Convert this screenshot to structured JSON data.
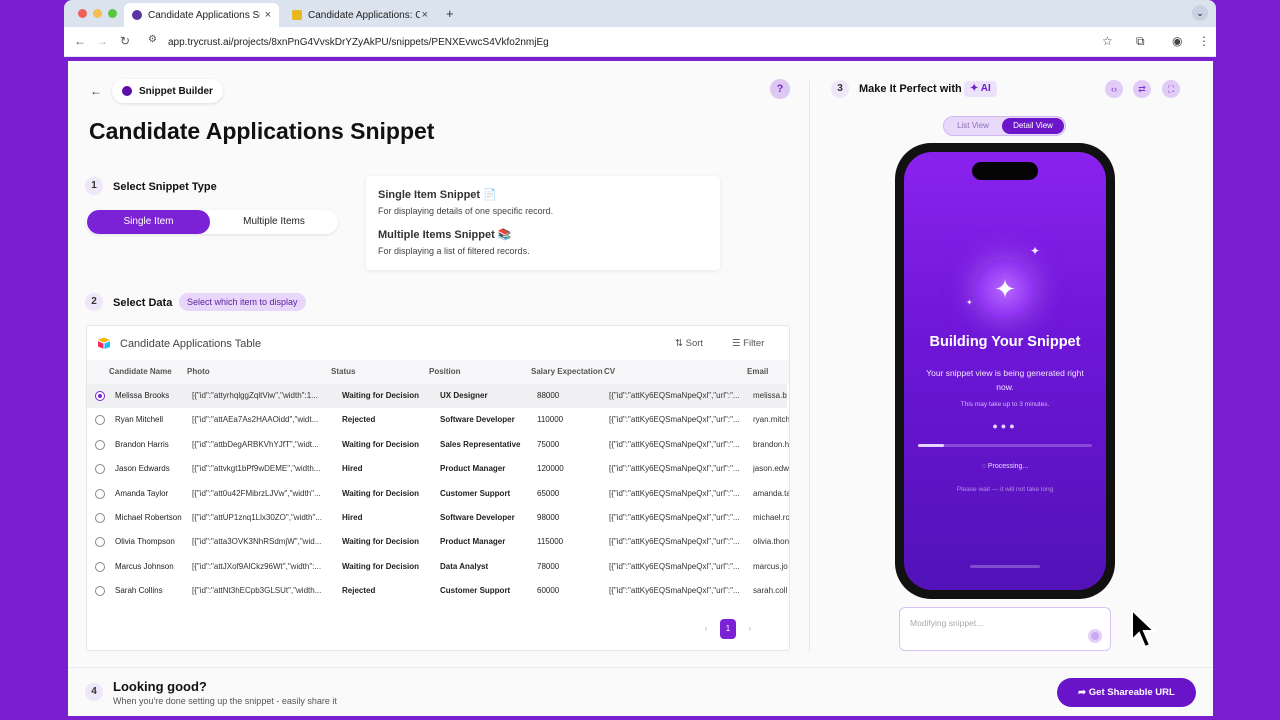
{
  "browser": {
    "tabs": [
      {
        "title": "Candidate Applications Snipp",
        "close": "×"
      },
      {
        "title": "Candidate Applications: Cand",
        "close": "×"
      }
    ],
    "new_tab": "+",
    "url": "app.trycrust.ai/projects/8xnPnG4VvskDrYZyAkPU/snippets/PENXEvwcS4Vkfo2nmjEg"
  },
  "builder": {
    "breadcrumb": "Snippet Builder",
    "title": "Candidate Applications Snippet",
    "step1": {
      "num": "1",
      "title": "Select Snippet Type",
      "options": [
        "Single Item",
        "Multiple Items"
      ],
      "selected": "Single Item"
    },
    "info": [
      {
        "title": "Single Item Snippet 📄",
        "desc": "For displaying details of one specific record."
      },
      {
        "title": "Multiple Items Snippet 📚",
        "desc": "For displaying a list of filtered records."
      }
    ],
    "step2": {
      "num": "2",
      "title": "Select Data",
      "hint": "Select which item to display"
    },
    "step4": {
      "num": "4",
      "title": "Looking good?",
      "desc": "When you're done setting up the snippet - easily share it"
    },
    "share_button": "Get Shareable URL"
  },
  "table": {
    "name": "Candidate Applications Table",
    "sort": "Sort",
    "filter": "Filter",
    "columns": [
      "Candidate Name",
      "Photo",
      "Status",
      "Position",
      "Salary Expectation",
      "CV",
      "Email"
    ],
    "rows": [
      {
        "name": "Melissa Brooks",
        "photo": "[{\"id\":\"attyrhqlggZqltViw\",\"width\":1...",
        "status": "Waiting for Decision",
        "position": "UX Designer",
        "salary": "88000",
        "cv": "[{\"id\":\"attKy6EQSmaNpeQxl\",\"url\":\"...",
        "email": "melissa.b",
        "selected": true
      },
      {
        "name": "Ryan Mitchell",
        "photo": "[{\"id\":\"attAEa7As2HAAOidd\",\"widt...",
        "status": "Rejected",
        "position": "Software Developer",
        "salary": "110000",
        "cv": "[{\"id\":\"attKy6EQSmaNpeQxl\",\"url\":\"...",
        "email": "ryan.mitch"
      },
      {
        "name": "Brandon Harris",
        "photo": "[{\"id\":\"attbDegARBKVhYJfT\",\"widt...",
        "status": "Waiting for Decision",
        "position": "Sales Representative",
        "salary": "75000",
        "cv": "[{\"id\":\"attKy6EQSmaNpeQxl\",\"url\":\"...",
        "email": "brandon.h"
      },
      {
        "name": "Jason Edwards",
        "photo": "[{\"id\":\"attvkgt1bPf9wDEME\",\"width...",
        "status": "Hired",
        "position": "Product Manager",
        "salary": "120000",
        "cv": "[{\"id\":\"attKy6EQSmaNpeQxl\",\"url\":\"...",
        "email": "jason.edw"
      },
      {
        "name": "Amanda Taylor",
        "photo": "[{\"id\":\"att0u42FMibrzLJVw\",\"width\"...",
        "status": "Waiting for Decision",
        "position": "Customer Support",
        "salary": "65000",
        "cv": "[{\"id\":\"attKy6EQSmaNpeQxl\",\"url\":\"...",
        "email": "amanda.ta"
      },
      {
        "name": "Michael Robertson",
        "photo": "[{\"id\":\"attUP1znq1Llx30ZO\",\"width\"...",
        "status": "Hired",
        "position": "Software Developer",
        "salary": "98000",
        "cv": "[{\"id\":\"attKy6EQSmaNpeQxl\",\"url\":\"...",
        "email": "michael.ro"
      },
      {
        "name": "Olivia Thompson",
        "photo": "[{\"id\":\"atta3OVK3NhRSdmjW\",\"wid...",
        "status": "Waiting for Decision",
        "position": "Product Manager",
        "salary": "115000",
        "cv": "[{\"id\":\"attKy6EQSmaNpeQxl\",\"url\":\"...",
        "email": "olivia.thon"
      },
      {
        "name": "Marcus Johnson",
        "photo": "[{\"id\":\"attJXof9AlCkz96Wt\",\"width\":...",
        "status": "Waiting for Decision",
        "position": "Data Analyst",
        "salary": "78000",
        "cv": "[{\"id\":\"attKy6EQSmaNpeQxl\",\"url\":\"...",
        "email": "marcus.jo"
      },
      {
        "name": "Sarah Collins",
        "photo": "[{\"id\":\"attNt3hECpb3GLSUt\",\"width...",
        "status": "Rejected",
        "position": "Customer Support",
        "salary": "60000",
        "cv": "[{\"id\":\"attKy6EQSmaNpeQxl\",\"url\":\"...",
        "email": "sarah.coll"
      }
    ],
    "page": "1",
    "prev": "‹",
    "next": "›"
  },
  "preview": {
    "step3_num": "3",
    "step3_title": "Make It Perfect with",
    "ai_badge": "✦ AI",
    "view_options": [
      "List View",
      "Detail View"
    ],
    "active_view": "Detail View",
    "phone": {
      "title": "Building Your Snippet",
      "subtitle": "Your snippet view is being generated right now.",
      "note": "This may take up to 3 minutes.",
      "processing": "Processing...",
      "wait": "Please wait — it will not take long",
      "progress": 0.15
    },
    "input_placeholder": "Modifying snippet..."
  },
  "colors": {
    "accent": "#7b21d6",
    "frame": "#7a1fd0"
  }
}
